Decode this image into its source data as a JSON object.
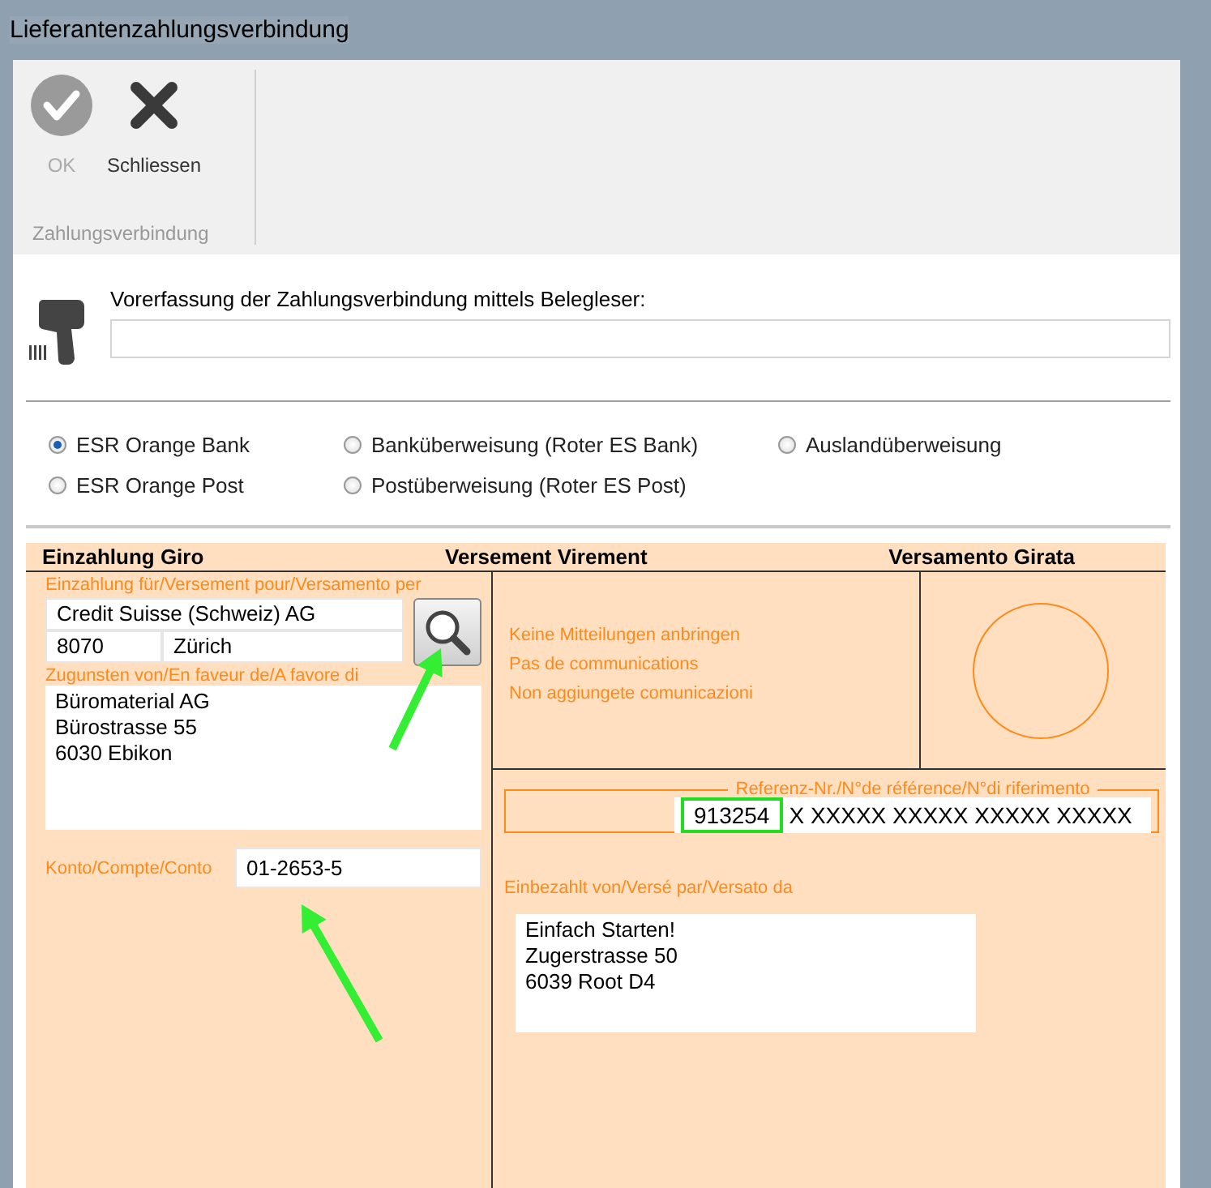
{
  "window": {
    "title": "Lieferantenzahlungsverbindung"
  },
  "toolbar": {
    "buttons": [
      {
        "label": "OK",
        "kind": "ok",
        "disabled": true
      },
      {
        "label": "Schliessen",
        "kind": "close",
        "disabled": false
      }
    ],
    "group_label": "Zahlungsverbindung"
  },
  "scanner": {
    "label": "Vorerfassung der Zahlungsverbindung mittels Belegleser:"
  },
  "payment_types": [
    {
      "label": "ESR Orange Bank",
      "selected": true
    },
    {
      "label": "ESR Orange Post",
      "selected": false
    },
    {
      "label": "Banküberweisung (Roter ES Bank)",
      "selected": false
    },
    {
      "label": "Postüberweisung (Roter ES Post)",
      "selected": false
    },
    {
      "label": "Auslandüberweisung",
      "selected": false
    }
  ],
  "slip": {
    "headers": [
      "Einzahlung Giro",
      "Versement Virement",
      "Versamento Girata"
    ],
    "bank_label": "Einzahlung für/Versement pour/Versamento per",
    "bank_name": "Credit Suisse (Schweiz) AG",
    "bank_zip": "8070",
    "bank_city": "Zürich",
    "beneficiary_label": "Zugunsten von/En faveur de/A favore di",
    "beneficiary_lines": [
      "Büromaterial AG",
      "Bürostrasse 55",
      "6030 Ebikon"
    ],
    "account_label": "Konto/Compte/Conto",
    "account": "01-2653-5",
    "notice_lines": [
      "Keine Mitteilungen anbringen",
      "Pas de communications",
      "Non aggiungete comunicazioni"
    ],
    "reference_label": "Referenz-Nr./N°de référence/N°di riferimento",
    "reference_value": "913254",
    "reference_mask": "X XXXXX XXXXX XXXXX XXXXX",
    "payer_label": "Einbezahlt von/Versé par/Versato da",
    "payer_lines": [
      "Einfach Starten!",
      "Zugerstrasse 50",
      "6039 Root D4"
    ]
  }
}
